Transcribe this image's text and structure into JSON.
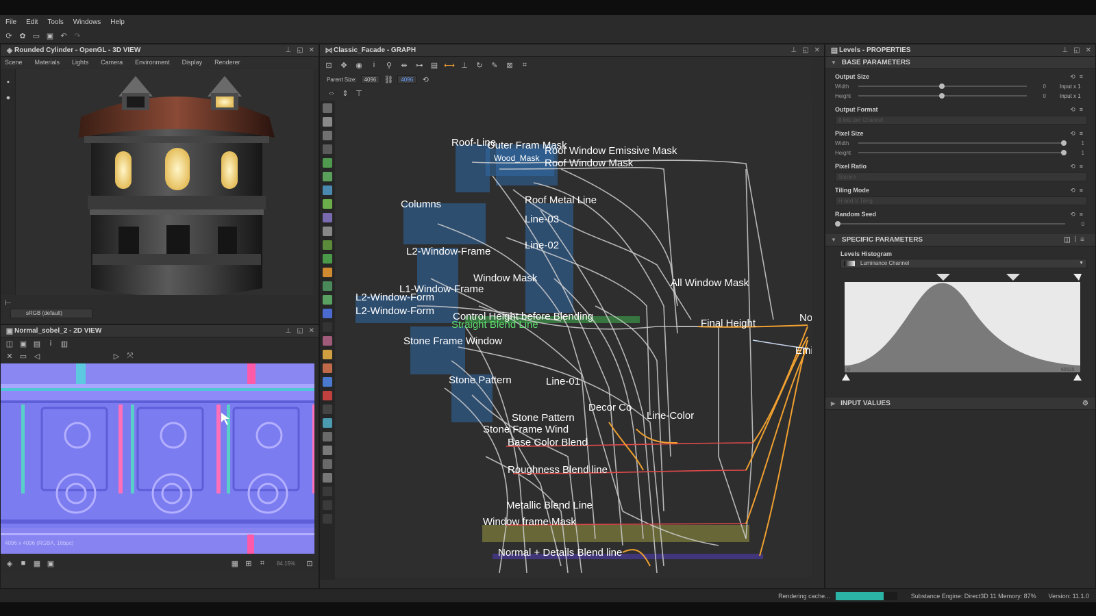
{
  "menu": [
    "File",
    "Edit",
    "Tools",
    "Windows",
    "Help"
  ],
  "view3d": {
    "title": "Rounded Cylinder - OpenGL - 3D VIEW",
    "tabs": [
      "Scene",
      "Materials",
      "Lights",
      "Camera",
      "Environment",
      "Display",
      "Renderer"
    ],
    "colorspace": "sRGB (default)"
  },
  "view2d": {
    "title": "Normal_sobel_2 - 2D VIEW",
    "info": "4096 x 4096 (RGBA, 16bpc)",
    "zoom": "84.15%"
  },
  "graph": {
    "title": "Classic_Facade - GRAPH",
    "parent_size_label": "Parent Size:",
    "parent_size": "4096",
    "size_value": "4096",
    "frames": [
      "Roof-Line",
      "Outer Fram Mask",
      "Wood_Mask",
      "Roof Window Emissive Mask",
      "Roof Window Mask",
      "Columns",
      "Roof Metal Line",
      "Line-03",
      "Line-02",
      "L2-Window-Frame",
      "Window Mask",
      "L1-Window-Frame",
      "L2-Window-Form",
      "L2-Window-Form",
      "All Window Mask",
      "Control Height before Blending",
      "Straight Blend Line",
      "Final Height",
      "Nor",
      "Stone Frame Window",
      "Stone Pattern",
      "Line-01",
      "Stone Pattern",
      "Decor Co",
      "Stone Frame Wind",
      "Line-Color",
      "Base Color Blend",
      "Roughness Blend line",
      "Metallic Blend Line",
      "Window frame Mask",
      "Normal + Details Blend line",
      "Emi"
    ]
  },
  "properties": {
    "title": "Levels - PROPERTIES",
    "base_header": "BASE PARAMETERS",
    "output_size": {
      "label": "Output Size",
      "width_label": "Width",
      "height_label": "Height",
      "width_value": "0",
      "height_value": "0",
      "width_extra": "Input x 1",
      "height_extra": "Input x 1"
    },
    "output_format": {
      "label": "Output Format",
      "value": "8 bits per Channel"
    },
    "pixel_size": {
      "label": "Pixel Size",
      "width_label": "Width",
      "height_label": "Height",
      "width_value": "1",
      "height_value": "1"
    },
    "pixel_ratio": {
      "label": "Pixel Ratio",
      "value": "Square"
    },
    "tiling_mode": {
      "label": "Tiling Mode",
      "value": "H and V Tiling"
    },
    "random_seed": {
      "label": "Random Seed",
      "value": "0"
    },
    "specific_header": "SPECIFIC PARAMETERS",
    "histogram_label": "Levels Histogram",
    "channel": "Luminance Channel",
    "hist_min": "0",
    "hist_max": "65535",
    "input_header": "INPUT VALUES"
  },
  "status": {
    "rendering": "Rendering cache...",
    "progress": 0.78,
    "engine": "Substance Engine: Direct3D 11  Memory: 87%",
    "version": "Version: 11.1.0"
  },
  "colors": {
    "accent": "#2bb3a6",
    "wire": "#c8c8c8",
    "orange": "#f0a030",
    "green": "#3fbf4f",
    "node_blue": "#3a6fa0"
  }
}
